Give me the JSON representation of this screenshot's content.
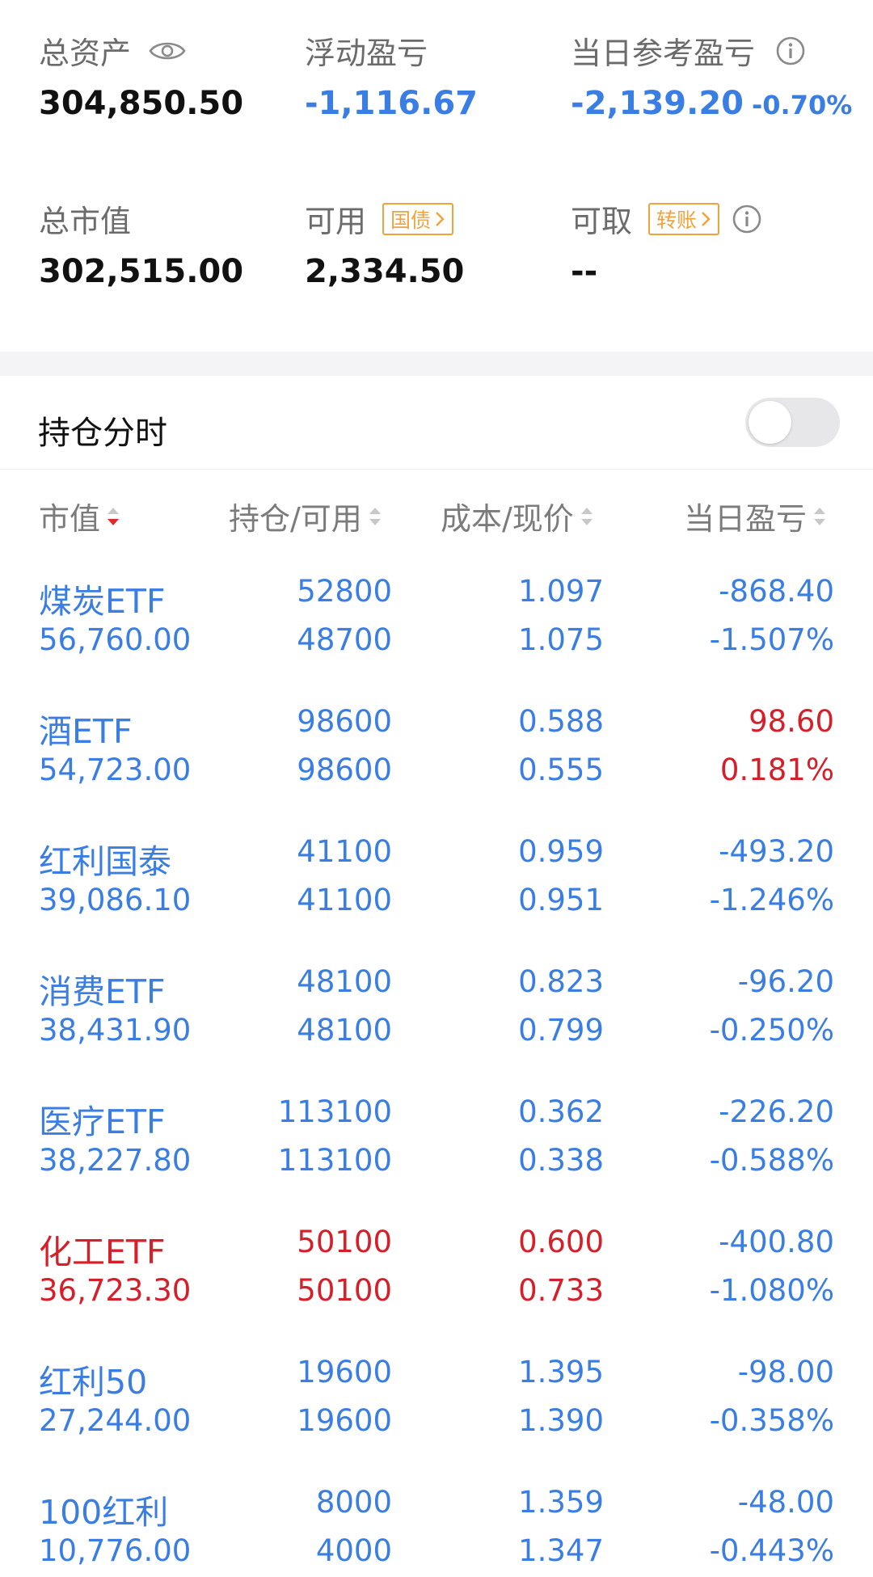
{
  "summary": {
    "total_assets_label": "总资产",
    "total_assets_value": "304,850.50",
    "floating_pnl_label": "浮动盈亏",
    "floating_pnl_value": "-1,116.67",
    "daily_pnl_label": "当日参考盈亏",
    "daily_pnl_value": "-2,139.20",
    "daily_pnl_pct": "-0.70%",
    "market_value_label": "总市值",
    "market_value_value": "302,515.00",
    "available_label": "可用",
    "available_tag": "国债",
    "available_value": "2,334.50",
    "withdrawable_label": "可取",
    "withdrawable_tag": "转账",
    "withdrawable_value": "--"
  },
  "position_timeline": {
    "label": "持仓分时",
    "enabled": false
  },
  "table": {
    "headers": {
      "market_value": "市值",
      "hold_avail": "持仓/可用",
      "cost_price": "成本/现价",
      "daily_pnl": "当日盈亏"
    },
    "rows": [
      {
        "name": "煤炭ETF",
        "market_value": "56,760.00",
        "hold": "52800",
        "avail": "48700",
        "cost": "1.097",
        "price": "1.075",
        "pnl": "-868.40",
        "pnl_pct": "-1.507%",
        "row_color": "blue",
        "pnl_color": "blue"
      },
      {
        "name": "酒ETF",
        "market_value": "54,723.00",
        "hold": "98600",
        "avail": "98600",
        "cost": "0.588",
        "price": "0.555",
        "pnl": "98.60",
        "pnl_pct": "0.181%",
        "row_color": "blue",
        "pnl_color": "red"
      },
      {
        "name": "红利国泰",
        "market_value": "39,086.10",
        "hold": "41100",
        "avail": "41100",
        "cost": "0.959",
        "price": "0.951",
        "pnl": "-493.20",
        "pnl_pct": "-1.246%",
        "row_color": "blue",
        "pnl_color": "blue"
      },
      {
        "name": "消费ETF",
        "market_value": "38,431.90",
        "hold": "48100",
        "avail": "48100",
        "cost": "0.823",
        "price": "0.799",
        "pnl": "-96.20",
        "pnl_pct": "-0.250%",
        "row_color": "blue",
        "pnl_color": "blue"
      },
      {
        "name": "医疗ETF",
        "market_value": "38,227.80",
        "hold": "113100",
        "avail": "113100",
        "cost": "0.362",
        "price": "0.338",
        "pnl": "-226.20",
        "pnl_pct": "-0.588%",
        "row_color": "blue",
        "pnl_color": "blue"
      },
      {
        "name": "化工ETF",
        "market_value": "36,723.30",
        "hold": "50100",
        "avail": "50100",
        "cost": "0.600",
        "price": "0.733",
        "pnl": "-400.80",
        "pnl_pct": "-1.080%",
        "row_color": "red",
        "pnl_color": "blue"
      },
      {
        "name": "红利50",
        "market_value": "27,244.00",
        "hold": "19600",
        "avail": "19600",
        "cost": "1.395",
        "price": "1.390",
        "pnl": "-98.00",
        "pnl_pct": "-0.358%",
        "row_color": "blue",
        "pnl_color": "blue"
      },
      {
        "name": "100红利",
        "market_value": "10,776.00",
        "hold": "8000",
        "avail": "4000",
        "cost": "1.359",
        "price": "1.347",
        "pnl": "-48.00",
        "pnl_pct": "-0.443%",
        "row_color": "blue",
        "pnl_color": "blue"
      }
    ]
  },
  "colors": {
    "blue": "#3a7ee4",
    "red": "#d5202a",
    "tag_orange": "#f1a33b"
  },
  "icons": {
    "eye": "eye-icon",
    "info": "info-icon",
    "chevron": "chevron-right-icon",
    "sort": "sort-icon"
  }
}
